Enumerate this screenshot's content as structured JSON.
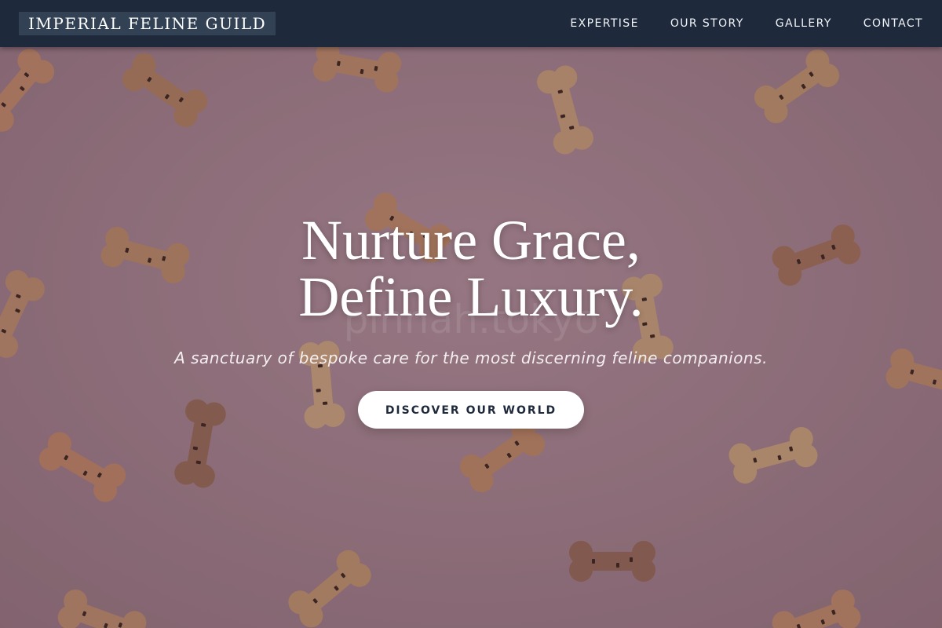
{
  "nav": {
    "brand": "IMPERIAL FELINE GUILD",
    "links": [
      {
        "label": "EXPERTISE"
      },
      {
        "label": "OUR STORY"
      },
      {
        "label": "GALLERY"
      },
      {
        "label": "CONTACT"
      }
    ]
  },
  "hero": {
    "title_line1": "Nurture Grace,",
    "title_line2": "Define Luxury.",
    "subtitle": "A sanctuary of bespoke care for the most discerning feline companions.",
    "cta_label": "DISCOVER OUR WORLD",
    "watermark": "pinnah.tokyo",
    "background": "dog-bone-biscuits-on-pink-background"
  },
  "colors": {
    "nav_bg": "#1e293b",
    "brand_bg": "#334155",
    "hero_bg": "#a8858d",
    "cta_text": "#1e293b",
    "cta_bg": "#ffffff"
  }
}
